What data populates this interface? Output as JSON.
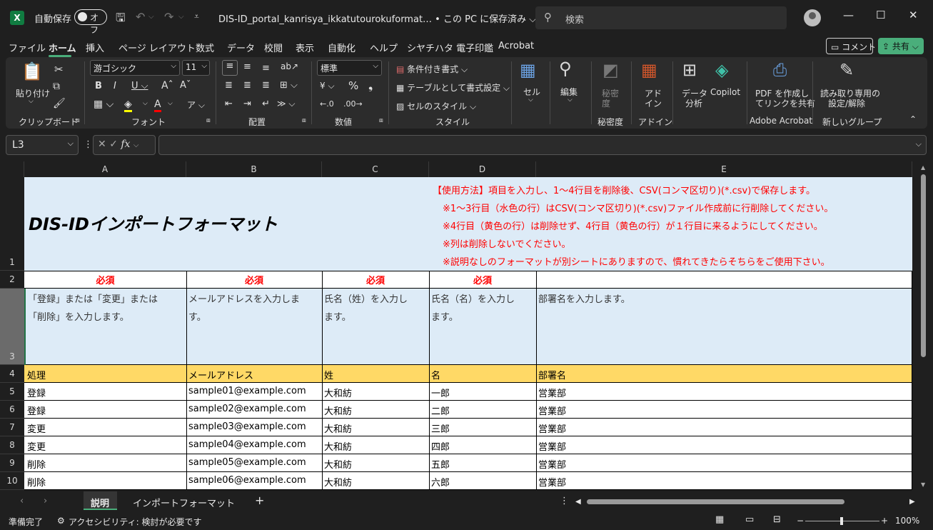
{
  "titlebar": {
    "autosave_label": "自動保存",
    "autosave_state": "オフ",
    "document_title": "DIS-ID_portal_kanrisya_ikkatutourokuformat… • この PC に保存済み ⌵",
    "search_placeholder": "検索"
  },
  "menu": {
    "tabs": [
      "ファイル",
      "ホーム",
      "挿入",
      "ページ レイアウト",
      "数式",
      "データ",
      "校閲",
      "表示",
      "自動化",
      "ヘルプ",
      "シヤチハタ 電子印鑑",
      "Acrobat"
    ],
    "active_tab": "ホーム",
    "comment_label": "コメント",
    "share_label": "共有"
  },
  "ribbon": {
    "paste_label": "貼り付け",
    "clipboard_group": "クリップボード",
    "font_name": "游ゴシック",
    "font_size": "11",
    "font_group": "フォント",
    "alignment_group": "配置",
    "number_format": "標準",
    "number_group": "数値",
    "conditional_format": "条件付き書式",
    "table_format": "テーブルとして書式設定",
    "cell_style": "セルのスタイル",
    "style_group": "スタイル",
    "cells_label": "セル",
    "editing_label": "編集",
    "sensitivity_label_1": "秘密",
    "sensitivity_label_2": "度",
    "sensitivity_group": "秘密度",
    "addin_label_1": "アド",
    "addin_label_2": "イン",
    "addin_group": "アドイン",
    "data_analysis_1": "データ",
    "data_analysis_2": "分析",
    "copilot_label": "Copilot",
    "pdf_label_1": "PDF を作成し",
    "pdf_label_2": "てリンクを共有",
    "adobe_group": "Adobe Acrobat",
    "readonly_label_1": "読み取り専用の",
    "readonly_label_2": "設定/解除",
    "new_group": "新しいグループ"
  },
  "formula_bar": {
    "name_box": "L3",
    "formula": ""
  },
  "columns": [
    "A",
    "B",
    "C",
    "D",
    "E"
  ],
  "rows": [
    "1",
    "2",
    "3",
    "4",
    "5",
    "6",
    "7",
    "8",
    "9",
    "10"
  ],
  "sheet": {
    "title": "DIS-IDインポートフォーマット",
    "instructions": [
      "【使用方法】項目を入力し、1～4行目を削除後、CSV(コンマ区切り)(*.csv)で保存します。",
      "※1～3行目（水色の行）はCSV(コンマ区切り)(*.csv)ファイル作成前に行削除してください。",
      "※4行目（黄色の行）は削除せず、4行目（黄色の行）が１行目に来るようにしてください。",
      "※列は削除しないでください。",
      "※説明なしのフォーマットが別シートにありますので、慣れてきたらそちらをご使用下さい。"
    ],
    "required": [
      "必須",
      "必須",
      "必須",
      "必須",
      ""
    ],
    "descriptions": [
      [
        "「登録」または「変更」または",
        "「削除」を入力します。"
      ],
      [
        "メールアドレスを入力しま",
        "す。"
      ],
      [
        "氏名（姓）を入力し",
        "ます。"
      ],
      [
        "氏名（名）を入力し",
        "ます。"
      ],
      [
        "部署名を入力します。",
        ""
      ]
    ],
    "headers": [
      "処理",
      "メールアドレス",
      "姓",
      "名",
      "部署名"
    ],
    "data_rows": [
      [
        "登録",
        "sample01@example.com",
        "大和紡",
        "一郎",
        "営業部"
      ],
      [
        "登録",
        "sample02@example.com",
        "大和紡",
        "二郎",
        "営業部"
      ],
      [
        "変更",
        "sample03@example.com",
        "大和紡",
        "三郎",
        "営業部"
      ],
      [
        "変更",
        "sample04@example.com",
        "大和紡",
        "四郎",
        "営業部"
      ],
      [
        "削除",
        "sample05@example.com",
        "大和紡",
        "五郎",
        "営業部"
      ],
      [
        "削除",
        "sample06@example.com",
        "大和紡",
        "六郎",
        "営業部"
      ]
    ]
  },
  "sheet_tabs": {
    "tabs": [
      "説明",
      "インポートフォーマット"
    ],
    "active": "説明",
    "add_label": "+"
  },
  "status": {
    "ready": "準備完了",
    "accessibility": "アクセシビリティ: 検討が必要です",
    "zoom": "100%"
  },
  "colors": {
    "accent": "#4aae7b",
    "light_blue": "#ddebf7",
    "yellow": "#ffd966",
    "red_text": "#ff0000"
  }
}
